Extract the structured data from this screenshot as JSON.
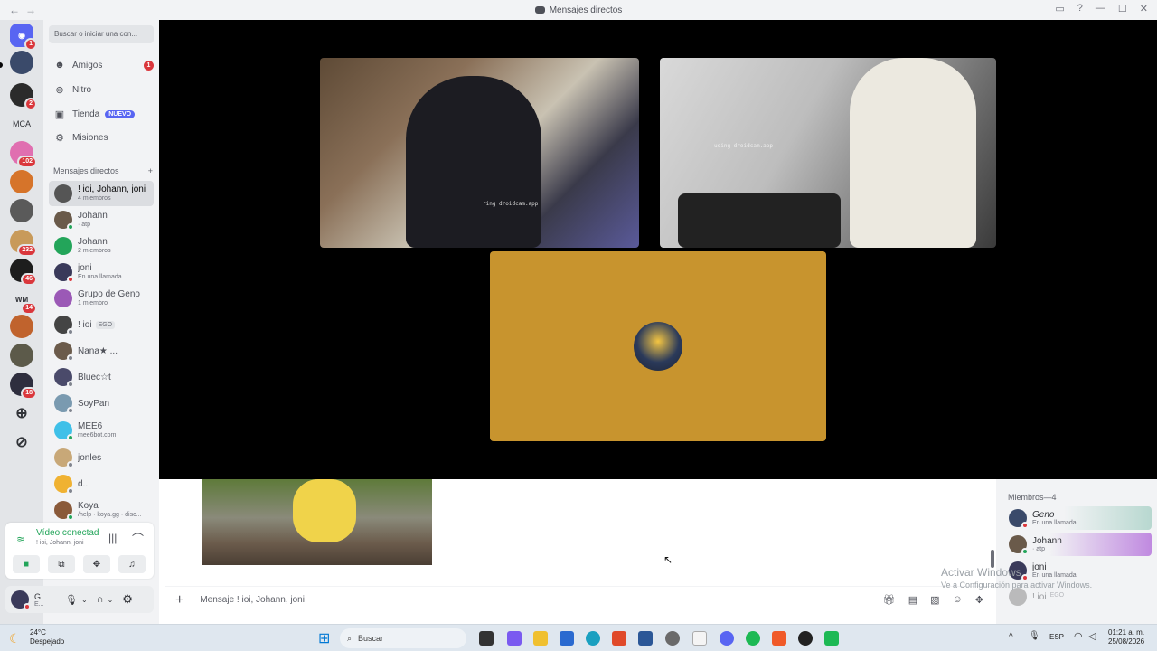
{
  "window": {
    "title": "Mensajes directos"
  },
  "rail": {
    "badges": [
      "1",
      "2",
      "102",
      "232",
      "46",
      "14",
      "18"
    ],
    "mca_label": "MCA",
    "wm_label": "WM"
  },
  "search": {
    "placeholder": "Buscar o iniciar una con..."
  },
  "nav": {
    "friends": "Amigos",
    "friends_badge": "1",
    "nitro": "Nitro",
    "shop": "Tienda",
    "shop_badge": "NUEVO",
    "missions": "Misiones"
  },
  "dm_header": {
    "label": "Mensajes directos",
    "add": "+"
  },
  "dms": [
    {
      "name": "! ioi, Johann, joni",
      "sub": "4 miembros"
    },
    {
      "name": "Johann",
      "sub": "· atp"
    },
    {
      "name": "Johann",
      "sub": "2 miembros"
    },
    {
      "name": "joni",
      "sub": "En una llamada"
    },
    {
      "name": "Grupo de Geno",
      "sub": "1 miembro"
    },
    {
      "name": "! ioi",
      "sub": "",
      "tag": "EGO"
    },
    {
      "name": "Nana★ ...",
      "sub": ""
    },
    {
      "name": "Bluec☆t",
      "sub": ""
    },
    {
      "name": "SoyPan",
      "sub": ""
    },
    {
      "name": "MEE6",
      "sub": "mee6bot.com"
    },
    {
      "name": "jonles",
      "sub": ""
    },
    {
      "name": "d...",
      "sub": ""
    },
    {
      "name": "Koya",
      "sub": "/help · koya.gg · disc..."
    }
  ],
  "voice": {
    "status": "Vídeo conectad",
    "channel": "! ioi, Johann, joni"
  },
  "user": {
    "name": "G...",
    "status": "E..."
  },
  "call": {
    "tile1_overlay": "ring droidcam.app",
    "tile2_overlay": "using droidcam.app"
  },
  "composer": {
    "placeholder": "Mensaje ! ioi, Johann, joni"
  },
  "members": {
    "header": "Miembros—4",
    "list": [
      {
        "name": "Geno",
        "sub": "En una llamada"
      },
      {
        "name": "Johann",
        "sub": "· atp"
      },
      {
        "name": "joni",
        "sub": "En una llamada"
      },
      {
        "name": "! ioi",
        "sub": "EGO"
      }
    ]
  },
  "watermark": {
    "line1": "Activar Windows",
    "line2": "Ve a Configuración para activar Windows."
  },
  "taskbar": {
    "temp": "24°C",
    "weather": "Despejado",
    "search": "Buscar",
    "lang": "ESP",
    "time": "01:21 a. m.",
    "date": "25/08/2026"
  },
  "colors": {
    "accent": "#5865f2",
    "red": "#da373c",
    "green": "#23a55a",
    "call_tile": "#c8942e"
  }
}
